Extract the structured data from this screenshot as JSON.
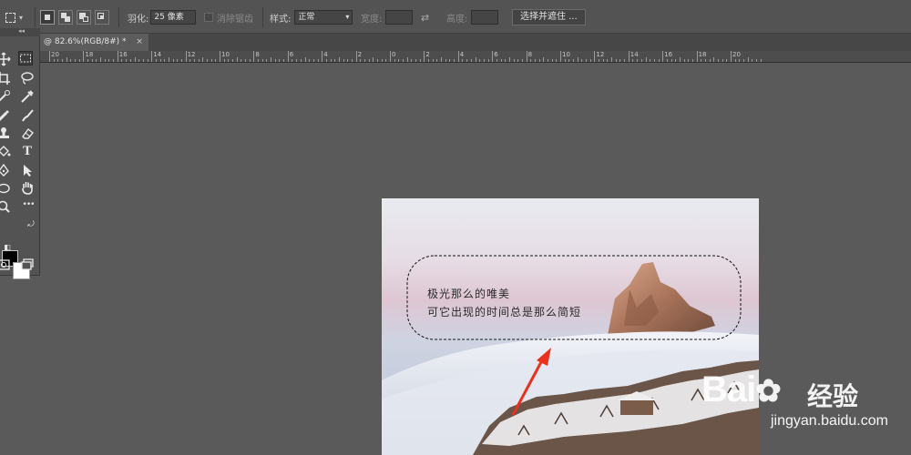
{
  "options": {
    "feather_label": "羽化:",
    "feather_value": "25 像素",
    "antialias_label": "消除锯齿",
    "style_label": "样式:",
    "style_value": "正常",
    "width_label": "宽度:",
    "height_label": "高度:",
    "select_mask_button": "选择并遮住 ...",
    "swap_icon": "swap-arrows-icon"
  },
  "document": {
    "tab_title": "@ 82.6%(RGB/8#) *",
    "close_glyph": "×"
  },
  "ruler": {
    "labels": [
      "20",
      "18",
      "16",
      "14",
      "12",
      "10",
      "8",
      "6",
      "4",
      "2",
      "0",
      "2",
      "4",
      "6",
      "8",
      "10",
      "12",
      "14",
      "16",
      "18",
      "20"
    ]
  },
  "tools": {
    "text_tool_glyph": "T",
    "more_glyph": "•••",
    "grip_glyph": "◂◂",
    "foreground_color": "#000000",
    "background_color": "#ffffff"
  },
  "canvas_text": {
    "line1": "极光那么的唯美",
    "line2": "可它出现的时间总是那么简短"
  },
  "watermark": {
    "logo": "Bai",
    "logo_tail": "du",
    "cn": "经验",
    "url": "jingyan.baidu.com"
  },
  "colors": {
    "app_bg": "#5a5a5a",
    "panel": "#535353",
    "arrow": "#e8321e"
  }
}
